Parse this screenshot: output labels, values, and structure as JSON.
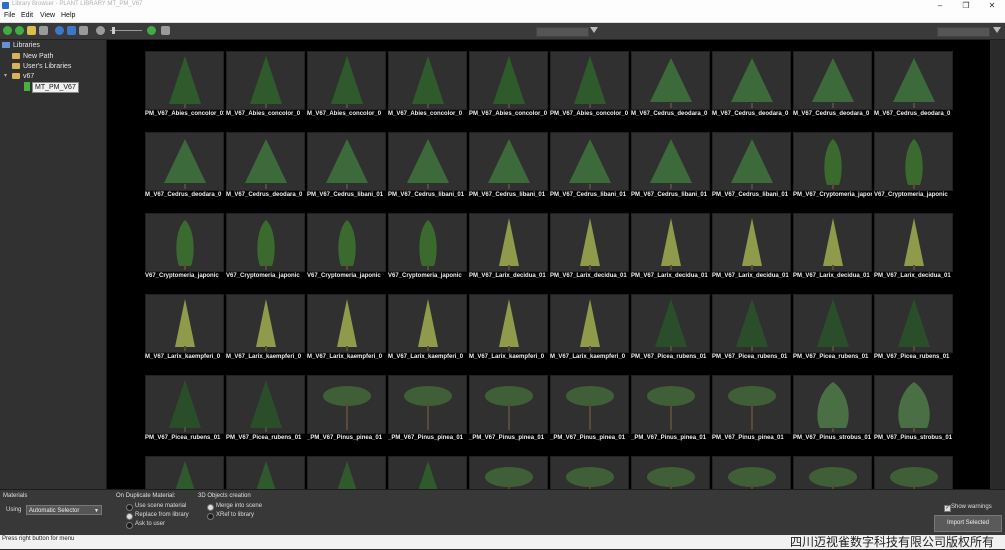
{
  "window": {
    "title": "Library Browser - PLANT LIBRARY MT_PM_V67",
    "controls": {
      "minimize": "–",
      "maximize": "❐",
      "close": "✕"
    }
  },
  "menu": [
    "File",
    "Edit",
    "View",
    "Help"
  ],
  "toolbar": {
    "colors": {
      "green": "#3fae3f",
      "blue": "#3c78c8",
      "yellow": "#d8c04a",
      "gray": "#9a9a9a"
    }
  },
  "sidebar": {
    "root": "Libraries",
    "items": [
      {
        "label": "New Path"
      },
      {
        "label": "User's Libraries"
      },
      {
        "label": "v67"
      }
    ],
    "selected": "MT_PM_V67"
  },
  "grid": {
    "labels": [
      "PM_V67_Abies_concolor_01",
      "M_V67_Abies_concolor_0",
      "M_V67_Abies_concolor_0",
      "M_V67_Abies_concolor_0",
      "PM_V67_Abies_concolor_0",
      "PM_V67_Abies_concolor_0",
      "M_V67_Cedrus_deodara_0",
      "M_V67_Cedrus_deodara_0",
      "M_V67_Cedrus_deodara_0",
      "M_V67_Cedrus_deodara_0",
      "M_V67_Cedrus_deodara_0",
      "M_V67_Cedrus_deodara_0",
      "PM_V67_Cedrus_libani_01",
      "PM_V67_Cedrus_libani_01",
      "PM_V67_Cedrus_libani_01",
      "PM_V67_Cedrus_libani_01",
      "PM_V67_Cedrus_libani_01",
      "PM_V67_Cedrus_libani_01",
      "PM_V67_Cryptomeria_japonic",
      "V67_Cryptomeria_japonic",
      "V67_Cryptomeria_japonic",
      "V67_Cryptomeria_japonic",
      "V67_Cryptomeria_japonic",
      "V67_Cryptomeria_japonic",
      "PM_V67_Larix_decidua_01",
      "PM_V67_Larix_decidua_01",
      "PM_V67_Larix_decidua_01",
      "PM_V67_Larix_decidua_01",
      "PM_V67_Larix_decidua_01",
      "PM_V67_Larix_decidua_01",
      "M_V67_Larix_kaempferi_0",
      "M_V67_Larix_kaempferi_0",
      "M_V67_Larix_kaempferi_0",
      "M_V67_Larix_kaempferi_0",
      "M_V67_Larix_kaempferi_0",
      "M_V67_Larix_kaempferi_0",
      "PM_V67_Picea_rubens_01",
      "PM_V67_Picea_rubens_01",
      "PM_V67_Picea_rubens_01",
      "PM_V67_Picea_rubens_01",
      "PM_V67_Picea_rubens_01",
      "PM_V67_Picea_rubens_01",
      "_PM_V67_Pinus_pinea_01",
      "_PM_V67_Pinus_pinea_01",
      "_PM_V67_Pinus_pinea_01",
      "_PM_V67_Pinus_pinea_01",
      "_PM_V67_Pinus_pinea_01",
      "PM_V67_Pinus_pinea_01",
      "PM_V67_Pinus_strobus_01",
      "PM_V67_Pinus_strobus_01",
      "",
      "",
      "",
      "",
      "",
      "",
      "",
      "",
      "",
      ""
    ],
    "shapes": [
      "conifer",
      "conifer",
      "conifer",
      "conifer",
      "conifer",
      "conifer",
      "cedar",
      "cedar",
      "cedar",
      "cedar",
      "cedar",
      "cedar",
      "cedar",
      "cedar",
      "cedar",
      "cedar",
      "cedar",
      "cedar",
      "column",
      "column",
      "column",
      "column",
      "column",
      "column",
      "larch",
      "larch",
      "larch",
      "larch",
      "larch",
      "larch",
      "larch",
      "larch",
      "larch",
      "larch",
      "larch",
      "larch",
      "spruce",
      "spruce",
      "spruce",
      "spruce",
      "spruce",
      "spruce",
      "pine",
      "pine",
      "pine",
      "pine",
      "pine",
      "pine",
      "strobus",
      "strobus",
      "conifer",
      "conifer",
      "conifer",
      "conifer",
      "pine",
      "pine",
      "pine",
      "pine",
      "pine",
      "pine"
    ],
    "colors": {
      "conifer": "#2f5a2c",
      "cedar": "#3d6a3a",
      "column": "#3a6a2e",
      "larch": "#8f9a4a",
      "spruce": "#2a4e2a",
      "pine": "#3f5f36",
      "strobus": "#4a6f44"
    }
  },
  "bottom": {
    "materials_title": "Materials",
    "using_label": "Using",
    "using_value": "Automatic Selector",
    "dup_title": "On Duplicate Material:",
    "dup_options": [
      "Use scene material",
      "Replace from library",
      "Ask to user"
    ],
    "dup_selected": 1,
    "objects_title": "3D Objects creation",
    "obj_options": [
      "Merge into scene",
      "XRef to library"
    ],
    "obj_selected": 0,
    "show_warnings": "Show warnings",
    "import_button": "Import Selected"
  },
  "status": "Press right button for menu",
  "watermark": "四川迈视雀数字科技有限公司版权所有"
}
